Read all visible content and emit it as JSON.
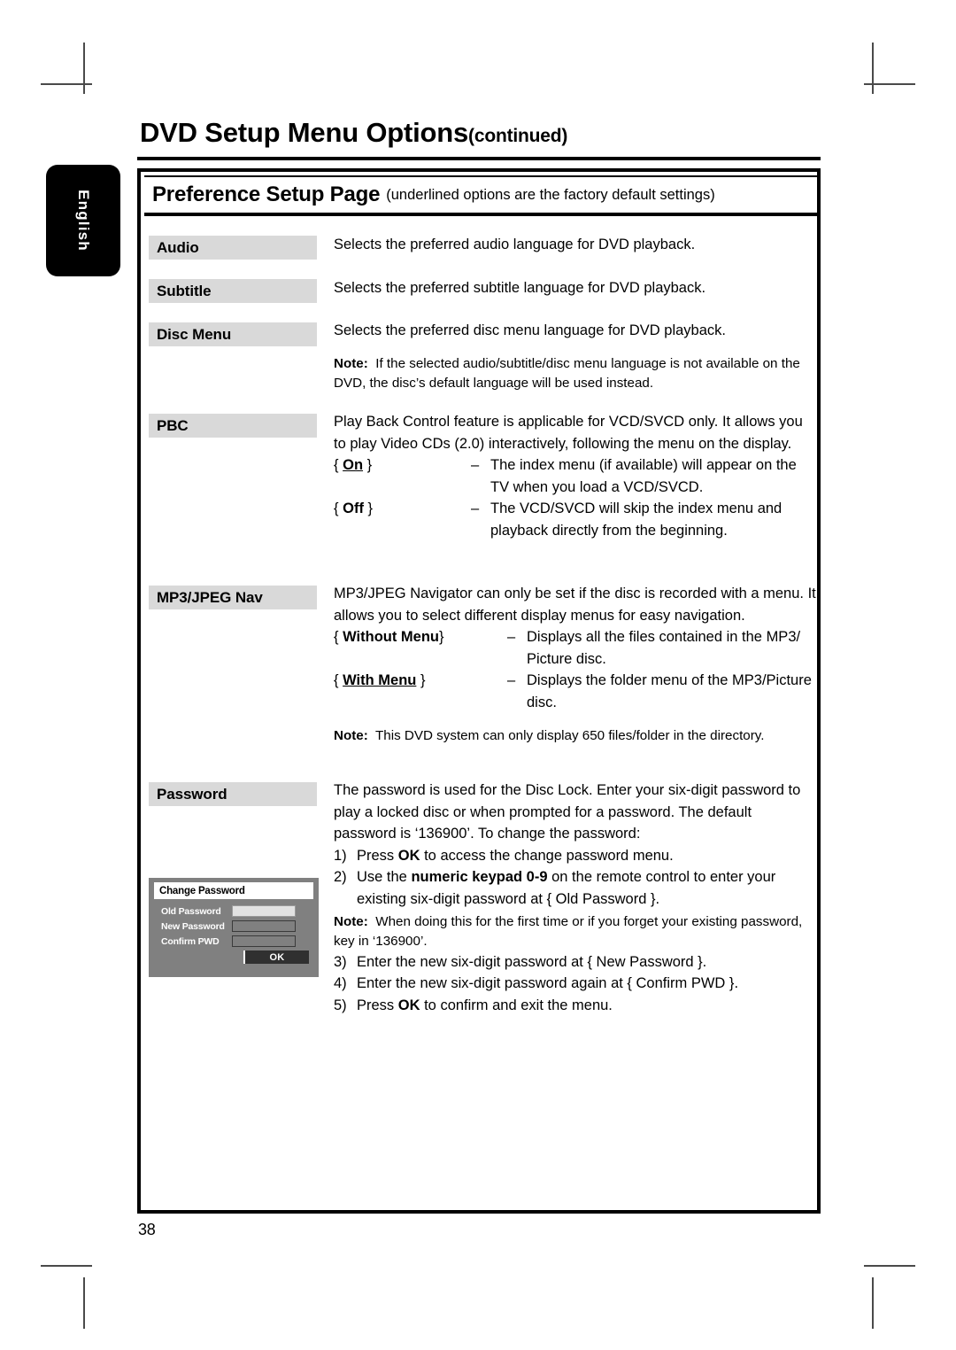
{
  "sidebar": {
    "language_tab": "English"
  },
  "header": {
    "title": "DVD Setup Menu Options",
    "continued": "(continued)"
  },
  "banner": {
    "title": "Preference Setup Page",
    "subtitle": "(underlined options are the factory default settings)"
  },
  "rows": {
    "audio": {
      "label": "Audio",
      "description": "Selects the preferred audio language for DVD playback."
    },
    "subtitle": {
      "label": "Subtitle",
      "description": "Selects the preferred subtitle language for DVD playback."
    },
    "disc_menu": {
      "label": "Disc Menu",
      "description": "Selects the preferred disc menu language for DVD playback.",
      "note_label": "Note:",
      "note_text": "If the selected audio/subtitle/disc menu language is not available on the DVD, the disc’s default language will be used instead."
    },
    "pbc": {
      "label": "PBC",
      "description": "Play Back Control feature is applicable for VCD/SVCD only.  It allows you to play Video CDs (2.0) interactively, following the menu on the display.",
      "options": [
        {
          "open": "{",
          "value": "On",
          "close": "}",
          "underlined": true,
          "dash": "–",
          "desc": "The index menu (if available) will appear on the TV when you load a VCD/SVCD."
        },
        {
          "open": "{",
          "value": "Off",
          "close": "}",
          "underlined": false,
          "dash": "–",
          "desc": "The VCD/SVCD will skip the index menu and playback directly from the beginning."
        }
      ]
    },
    "mp3_jpeg_nav": {
      "label": "MP3/JPEG Nav",
      "description": "MP3/JPEG Navigator can only be set if the disc is recorded with a menu.  It allows you to select different display menus for easy navigation.",
      "options": [
        {
          "open": "{",
          "value": "Without Menu",
          "close": "}",
          "underlined": false,
          "dash": "–",
          "desc": "Displays all the files contained in the MP3/ Picture disc."
        },
        {
          "open": "{",
          "value": "With Menu",
          "close": "}",
          "underlined": true,
          "dash": "–",
          "desc": "Displays the folder menu of the MP3/Picture disc."
        }
      ],
      "note_label": "Note:",
      "note_text": "This DVD system can only display 650 files/folder in the directory."
    },
    "password": {
      "label": "Password",
      "description_pre": "The password is used for the Disc Lock.  Enter your six-digit password to play a locked disc or when prompted for a password.  The default password is ‘136900’.  To change the password:",
      "steps": [
        {
          "num": "1)",
          "text_a": "Press ",
          "bold": "OK",
          "text_b": " to access the change password menu."
        },
        {
          "num": "2)",
          "text_a": "Use the ",
          "bold": "numeric keypad 0-9",
          "text_b": " on the remote control to enter your existing six-digit password at { Old Password }."
        }
      ],
      "note_label": "Note:",
      "note_text": "When doing this for the first time or if you forget your existing password, key in ‘136900’.",
      "steps_after": [
        {
          "num": "3)",
          "text_a": "Enter the new six-digit password at { New Password }.",
          "bold": "",
          "text_b": ""
        },
        {
          "num": "4)",
          "text_a": "Enter the new six-digit password again at { Confirm PWD }.",
          "bold": "",
          "text_b": ""
        },
        {
          "num": "5)",
          "text_a": "Press ",
          "bold": "OK",
          "text_b": " to confirm and exit the menu."
        }
      ]
    }
  },
  "osd_figure": {
    "title": "Change Password",
    "fields": [
      {
        "label": "Old Password",
        "active": true
      },
      {
        "label": "New Password",
        "active": false
      },
      {
        "label": "Confirm PWD",
        "active": false
      }
    ],
    "ok_button": "OK"
  },
  "footer": {
    "page_number": "38"
  },
  "colors": {
    "label_background": "#d9d9d9",
    "osd_background": "#808080",
    "osd_button": "#303030",
    "rule": "#000000"
  }
}
